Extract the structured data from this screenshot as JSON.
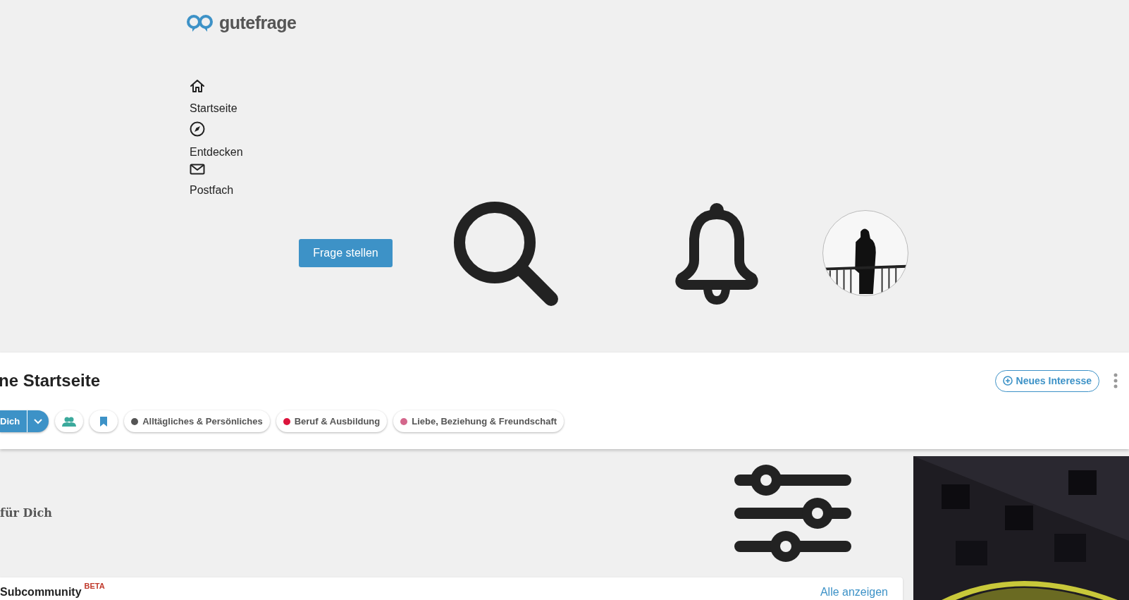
{
  "logo": {
    "text": "gutefrage"
  },
  "nav": [
    {
      "kind": "home",
      "label": "Startseite"
    },
    {
      "kind": "explore",
      "label": "Entdecken"
    },
    {
      "kind": "mail",
      "label": "Postfach"
    }
  ],
  "header": {
    "ask_button": "Frage stellen"
  },
  "feed": {
    "title": "ne Startseite",
    "new_interest_button": "Neues Interesse",
    "chips": [
      {
        "kind": "dropdown",
        "label": "Dich",
        "selected": true
      },
      {
        "kind": "people",
        "selected": false
      },
      {
        "kind": "bookmark",
        "selected": false
      },
      {
        "kind": "topic",
        "label": "Alltägliches & Persönliches",
        "color": "#555555",
        "selected": false
      },
      {
        "kind": "topic",
        "label": "Beruf & Ausbildung",
        "color": "#dc143c",
        "selected": false
      },
      {
        "kind": "topic",
        "label": "Liebe, Beziehung & Freundschaft",
        "color": "#d4678c",
        "selected": false
      }
    ]
  },
  "section": {
    "heading": "für Dich"
  },
  "subcommunity_card": {
    "title": "Subcommunity",
    "badge": "BETA",
    "link": "Alle anzeigen"
  }
}
